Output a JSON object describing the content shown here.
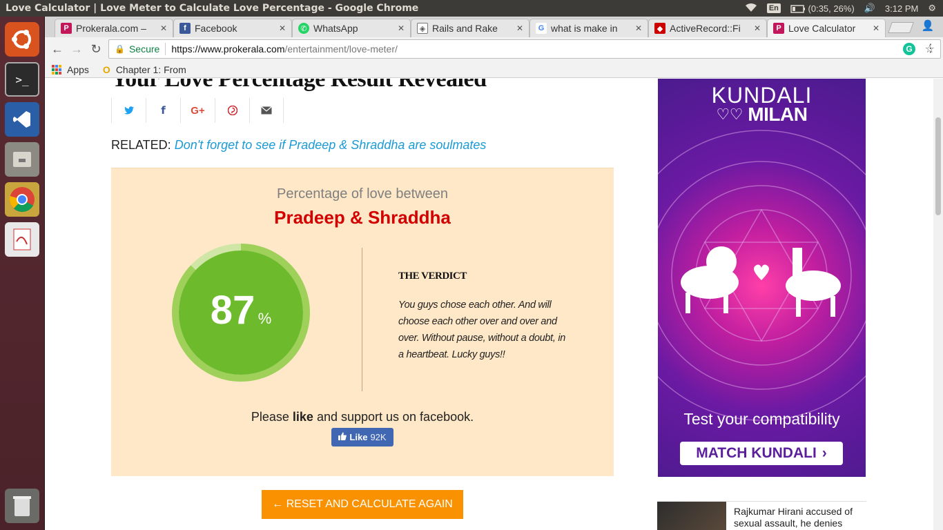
{
  "system": {
    "window_title": "Love Calculator | Love Meter to Calculate Love Percentage - Google Chrome",
    "lang": "En",
    "battery": "(0:35, 26%)",
    "clock": "3:12 PM"
  },
  "tabs": [
    {
      "title": "Prokerala.com –",
      "fav_color": "#c2185b",
      "fav_glyph": "P"
    },
    {
      "title": "Facebook",
      "fav_color": "#3b5998",
      "fav_glyph": "f"
    },
    {
      "title": "WhatsApp",
      "fav_color": "#25d366",
      "fav_glyph": "✆"
    },
    {
      "title": "Rails and Rake",
      "fav_color": "#555555",
      "fav_glyph": "◈"
    },
    {
      "title": "what is make in",
      "fav_color": "#4285f4",
      "fav_glyph": "G"
    },
    {
      "title": "ActiveRecord::Fi",
      "fav_color": "#cc0000",
      "fav_glyph": "◆"
    },
    {
      "title": "Love Calculator",
      "fav_color": "#c2185b",
      "fav_glyph": "P"
    }
  ],
  "address": {
    "secure_label": "Secure",
    "url_host": "https://www.prokerala.com",
    "url_path": "/entertainment/love-meter/"
  },
  "bookmarks": {
    "apps": "Apps",
    "chapter": "Chapter 1: From"
  },
  "page": {
    "heading": "Your Love Percentage Result Revealed",
    "related_prefix": "RELATED:",
    "related_link": "Don't forget to see if Pradeep & Shraddha are soulmates",
    "result_label": "Percentage of love between",
    "names": "Pradeep & Shraddha",
    "percentage": "87",
    "percent_sign": "%",
    "verdict_title": "THE VERDICT",
    "verdict_text": "You guys chose each other. And will choose each other over and over and over. Without pause, without a doubt, in a heartbeat. Lucky guys!!",
    "support_pre": "Please ",
    "support_bold": "like",
    "support_post": " and support us on facebook.",
    "like_label": "Like",
    "like_count": "92K",
    "reset_button": "← RESET AND CALCULATE AGAIN"
  },
  "ad": {
    "brand_line1": "KUNDALI",
    "brand_line2": "MILAN",
    "tagline": "Test your compatibility",
    "cta": "MATCH KUNDALI"
  },
  "news": {
    "headline": "Rajkumar Hirani accused of sexual assault, he denies"
  },
  "colors": {
    "accent_orange": "#f99100",
    "result_bg": "#ffe8c7",
    "names_red": "#d20000",
    "gauge_green": "#6dbb2d"
  },
  "gauge_fraction": 0.87
}
